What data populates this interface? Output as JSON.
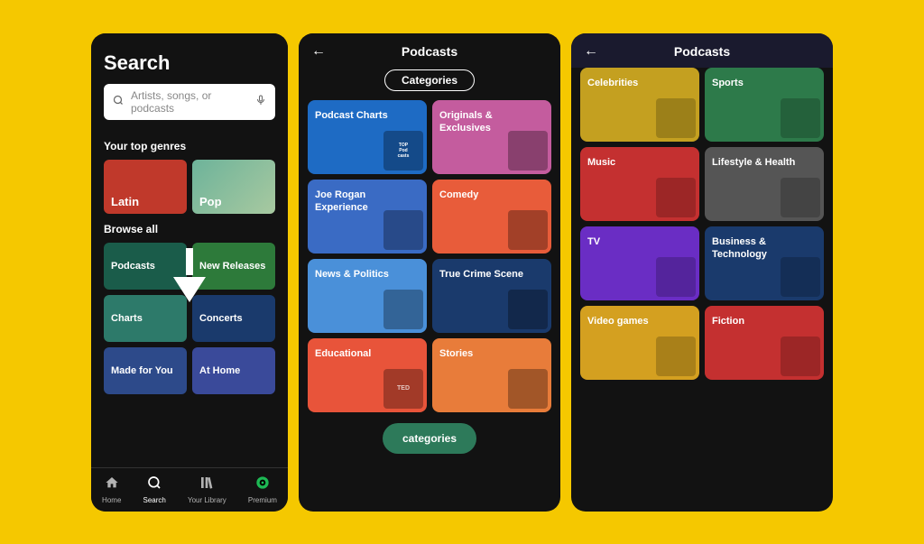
{
  "background_color": "#f5c800",
  "screen1": {
    "title": "Search",
    "search_placeholder": "Artists, songs, or podcasts",
    "top_genres_label": "Your top genres",
    "browse_label": "Browse all",
    "genres": [
      {
        "id": "latin",
        "label": "Latin",
        "color": "latin"
      },
      {
        "id": "pop",
        "label": "Pop",
        "color": "pop"
      }
    ],
    "browse_items": [
      {
        "id": "podcasts",
        "label": "Podcasts",
        "color": "podcasts"
      },
      {
        "id": "new-releases",
        "label": "New Releases",
        "color": "new-releases"
      },
      {
        "id": "charts",
        "label": "Charts",
        "color": "charts"
      },
      {
        "id": "concerts",
        "label": "Concerts",
        "color": "concerts"
      },
      {
        "id": "made-for-you",
        "label": "Made for You",
        "color": "made-for-you"
      },
      {
        "id": "at-home",
        "label": "At Home",
        "color": "at-home"
      }
    ],
    "nav": [
      {
        "label": "Home",
        "icon": "⌂",
        "active": false
      },
      {
        "label": "Search",
        "icon": "⌕",
        "active": true
      },
      {
        "label": "Your Library",
        "icon": "≡",
        "active": false
      },
      {
        "label": "Premium",
        "icon": "◉",
        "active": false
      }
    ]
  },
  "screen2": {
    "title": "Podcasts",
    "tab_label": "Categories",
    "tiles": [
      {
        "id": "podcast-charts",
        "label": "Podcast Charts",
        "color": "pt-podcast-charts"
      },
      {
        "id": "originals",
        "label": "Originals & Exclusives",
        "color": "pt-originals"
      },
      {
        "id": "joe-rogan",
        "label": "Joe Rogan Experience",
        "color": "pt-joe-rogan"
      },
      {
        "id": "comedy",
        "label": "Comedy",
        "color": "pt-comedy"
      },
      {
        "id": "news-politics",
        "label": "News & Politics",
        "color": "pt-news"
      },
      {
        "id": "true-crime",
        "label": "True Crime Scene",
        "color": "pt-true-crime"
      },
      {
        "id": "educational",
        "label": "Educational",
        "color": "pt-educational"
      },
      {
        "id": "stories",
        "label": "Stories",
        "color": "pt-stories"
      }
    ],
    "categories_btn": "categories"
  },
  "screen3": {
    "title": "Podcasts",
    "tiles": [
      {
        "id": "celebrities",
        "label": "Celebrities",
        "color": "st-celebrities"
      },
      {
        "id": "sports",
        "label": "Sports",
        "color": "st-sports"
      },
      {
        "id": "music",
        "label": "Music",
        "color": "st-music"
      },
      {
        "id": "lifestyle-health",
        "label": "Lifestyle & Health",
        "color": "st-lifestyle"
      },
      {
        "id": "tv",
        "label": "TV",
        "color": "st-tv"
      },
      {
        "id": "business-tech",
        "label": "Business & Technology",
        "color": "st-business"
      },
      {
        "id": "video-games",
        "label": "Video games",
        "color": "st-videogames"
      },
      {
        "id": "fiction",
        "label": "Fiction",
        "color": "st-fiction"
      }
    ]
  }
}
